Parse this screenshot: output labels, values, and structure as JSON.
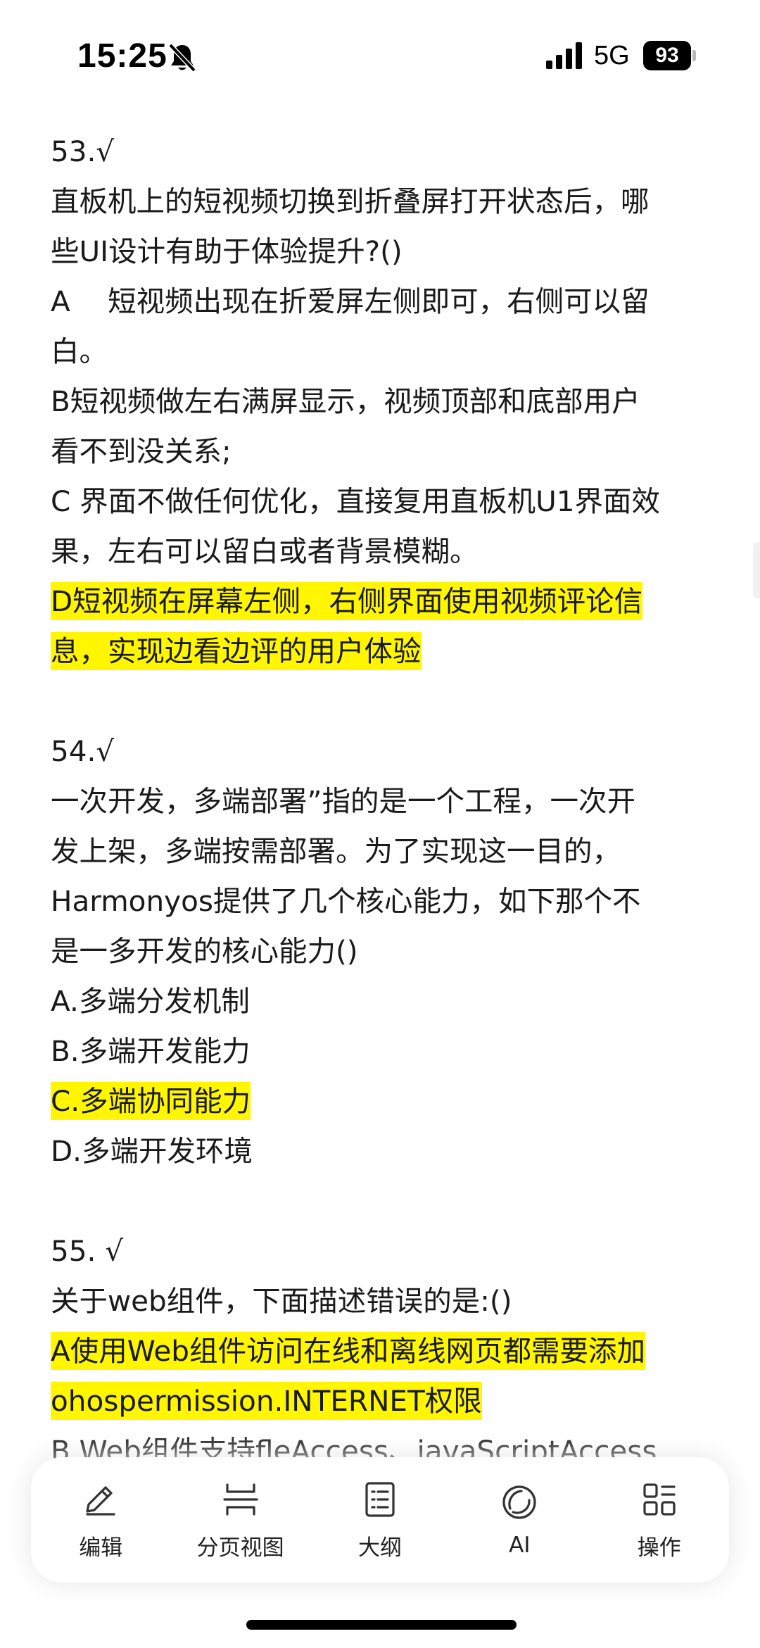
{
  "status_bar": {
    "time": "15:25",
    "network": "5G",
    "battery": "93"
  },
  "questions": [
    {
      "lines": [
        {
          "text": "53.√",
          "highlight": false
        },
        {
          "text": "直板机上的短视频切换到折叠屏打开状态后，哪",
          "highlight": false
        },
        {
          "text": "些UI设计有助于体验提升?()",
          "highlight": false
        },
        {
          "text": "A　 短视频出现在折爱屏左侧即可，右侧可以留",
          "highlight": false
        },
        {
          "text": "白。",
          "highlight": false
        },
        {
          "text": "B短视频做左右满屏显示，视频顶部和底部用户",
          "highlight": false
        },
        {
          "text": "看不到没关系;",
          "highlight": false
        },
        {
          "text": "C 界面不做任何优化，直接复用直板机U1界面效",
          "highlight": false
        },
        {
          "text": "果，左右可以留白或者背景模糊。",
          "highlight": false
        },
        {
          "text": "D短视频在屏幕左侧，右侧界面使用视频评论信",
          "highlight": true
        },
        {
          "text": "息，实现边看边评的用户体验",
          "highlight": true
        }
      ]
    },
    {
      "lines": [
        {
          "text": "54.√",
          "highlight": false
        },
        {
          "text": "一次开发，多端部署”指的是一个工程，一次开",
          "highlight": false
        },
        {
          "text": "发上架，多端按需部署。为了实现这一目的，",
          "highlight": false
        },
        {
          "text": "Harmonyos提供了几个核心能力，如下那个不",
          "highlight": false
        },
        {
          "text": "是一多开发的核心能力()",
          "highlight": false
        },
        {
          "text": "A.多端分发机制",
          "highlight": false
        },
        {
          "text": "B.多端开发能力",
          "highlight": false
        },
        {
          "text": "C.多端协同能力",
          "highlight": true
        },
        {
          "text": "D.多端开发环境",
          "highlight": false
        }
      ]
    },
    {
      "lines": [
        {
          "text": "55. √",
          "highlight": false
        },
        {
          "text": "关于web组件，下面描述错误的是:()",
          "highlight": false
        },
        {
          "text": "A使用Web组件访问在线和离线网页都需要添加",
          "highlight": true
        },
        {
          "text": "ohospermission.INTERNET权限",
          "highlight": true
        },
        {
          "text": "B Web组件支持fleAccess、javaScriptAccess",
          "highlight": false
        }
      ]
    }
  ],
  "toolbar": {
    "items": [
      {
        "label": "编辑",
        "icon": "pencil-icon"
      },
      {
        "label": "分页视图",
        "icon": "page-view-icon"
      },
      {
        "label": "大纲",
        "icon": "outline-icon"
      },
      {
        "label": "AI",
        "icon": "ai-icon"
      },
      {
        "label": "操作",
        "icon": "grid-icon"
      }
    ]
  },
  "colors": {
    "highlight": "#fff600",
    "text": "#1a1a1a"
  }
}
